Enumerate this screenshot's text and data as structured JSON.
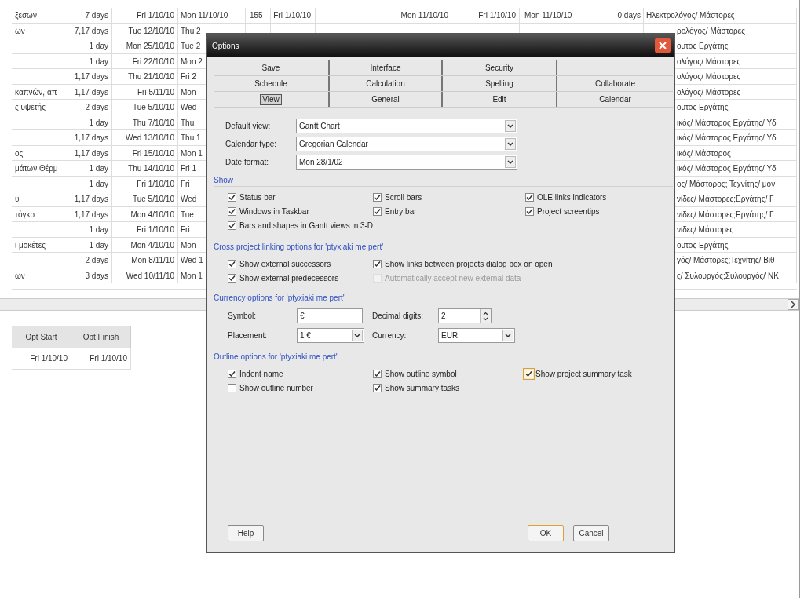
{
  "table": {
    "rows": [
      {
        "column_1": "ξεσων",
        "column_2": "7 days",
        "column_3": "Fri 1/10/10",
        "column_4": "Mon 11/10/10",
        "column_5": "155",
        "column_6": "Fri 1/10/10",
        "column_7": "Mon 11/10/10",
        "column_8": "Fri 1/10/10",
        "column_9": "Mon 11/10/10",
        "column_10": "0 days",
        "column_11": "Ηλεκτρολόγος/ Μάστορες"
      },
      {
        "column_1": "ων",
        "column_2": "7,17 days",
        "column_3": "Tue 12/10/10",
        "column_4": "Thu 2",
        "column_11": "ρολόγος/ Μάστορες"
      },
      {
        "column_2": "1 day",
        "column_3": "Mon 25/10/10",
        "column_4": "Tue 2",
        "column_11": "ουτος Εργάτης"
      },
      {
        "column_2": "1 day",
        "column_3": "Fri 22/10/10",
        "column_4": "Mon 2",
        "column_11": "ολόγος/ Μάστορες"
      },
      {
        "column_2": "1,17 days",
        "column_3": "Thu 21/10/10",
        "column_4": "Fri 2",
        "column_11": "ολόγος/ Μάστορες"
      },
      {
        "column_1": "καπνών, απ",
        "column_2": "1,17 days",
        "column_3": "Fri 5/11/10",
        "column_4": "Mon",
        "column_11": "ολόγος/ Μάστορες"
      },
      {
        "column_1": "ς υψετής",
        "column_2": "2 days",
        "column_3": "Tue 5/10/10",
        "column_4": "Wed",
        "column_11": "ουτος Εργάτης"
      },
      {
        "column_2": "1 day",
        "column_3": "Thu 7/10/10",
        "column_4": "Thu",
        "column_11": "ικός/ Μάστορος Εργάτης/ Υδ"
      },
      {
        "column_2": "1,17 days",
        "column_3": "Wed 13/10/10",
        "column_4": "Thu 1",
        "column_11": "ικός/ Μάστορος Εργάτης/ Υδ"
      },
      {
        "column_1": "ος",
        "column_2": "1,17 days",
        "column_3": "Fri 15/10/10",
        "column_4": "Mon 1",
        "column_11": "ικός/ Μάστορος"
      },
      {
        "column_1": "μάτων Θέρμ",
        "column_2": "1 day",
        "column_3": "Thu 14/10/10",
        "column_4": "Fri 1",
        "column_11": "ικός/ Μάστορος Εργάτης/ Υδ"
      },
      {
        "column_2": "1 day",
        "column_3": "Fri 1/10/10",
        "column_4": "Fri",
        "column_11": "ος/ Μάστορος; Τεχνίτης/ μον"
      },
      {
        "column_1": "υ",
        "column_2": "1,17 days",
        "column_3": "Tue 5/10/10",
        "column_4": "Wed",
        "column_11": "νίδες/ Μάστορες;Εργάτης/ Γ"
      },
      {
        "column_1": "τόγκο",
        "column_2": "1,17 days",
        "column_3": "Mon 4/10/10",
        "column_4": "Tue",
        "column_11": "νίδες/ Μάστορες;Εργάτης/ Γ"
      },
      {
        "column_2": "1 day",
        "column_3": "Fri 1/10/10",
        "column_4": "Fri",
        "column_11": "νίδες/ Μάστορες"
      },
      {
        "column_1": "ι μοκέτες",
        "column_2": "1 day",
        "column_3": "Mon 4/10/10",
        "column_4": "Mon",
        "column_11": "ουτος Εργάτης"
      },
      {
        "column_2": "2 days",
        "column_3": "Mon 8/11/10",
        "column_4": "Wed 1",
        "column_11": "γός/ Μάστορες;Τεχνίτης/ Βιθ"
      },
      {
        "column_1": "ων",
        "column_2": "3 days",
        "column_3": "Wed 10/11/10",
        "column_4": "Mon 1",
        "column_11": "ς/ Συλουργός;Συλουργός/ ΝΚ"
      }
    ]
  },
  "lower_table": {
    "columns": [
      "Opt Start",
      "Opt Finish"
    ],
    "rows": [
      [
        "Fri 1/10/10",
        "Fri 1/10/10"
      ]
    ]
  },
  "dialog": {
    "title": "Options",
    "tabs": [
      [
        {
          "label": "Save",
          "selected": false
        },
        {
          "label": "Interface",
          "selected": false
        },
        {
          "label": "Security",
          "selected": false
        }
      ],
      [
        {
          "label": "Schedule",
          "selected": false
        },
        {
          "label": "Calculation",
          "selected": false
        },
        {
          "label": "Spelling",
          "selected": false
        },
        {
          "label": "Collaborate",
          "selected": false
        }
      ],
      [
        {
          "label": "View",
          "selected": true
        },
        {
          "label": "General",
          "selected": false
        },
        {
          "label": "Edit",
          "selected": false
        },
        {
          "label": "Calendar",
          "selected": false
        }
      ]
    ],
    "fields": [
      {
        "label": "Default view:",
        "value": "Gantt Chart"
      },
      {
        "label": "Calendar type:",
        "value": "Gregorian Calendar"
      },
      {
        "label": "Date format:",
        "value": "Mon 28/1/02"
      }
    ],
    "show": {
      "heading": "Show",
      "checkboxes": [
        {
          "label": "Status bar",
          "checked": true,
          "disabled": false,
          "focused": false
        },
        {
          "label": "Scroll bars",
          "checked": true,
          "disabled": false,
          "focused": false
        },
        {
          "label": "OLE links indicators",
          "checked": true,
          "disabled": false,
          "focused": false
        },
        {
          "label": "Windows in Taskbar",
          "checked": true,
          "disabled": false,
          "focused": false
        },
        {
          "label": "Entry bar",
          "checked": true,
          "disabled": false,
          "focused": false
        },
        {
          "label": "Project screentips",
          "checked": true,
          "disabled": false,
          "focused": false
        },
        {
          "label": "Bars and shapes in Gantt views in 3-D",
          "checked": true,
          "disabled": false,
          "focused": false
        }
      ]
    },
    "cross_project": {
      "heading": "Cross project linking options for 'ptyxiaki me pert'",
      "checkboxes": [
        {
          "label": "Show external successors",
          "checked": true,
          "disabled": false,
          "focused": false
        },
        {
          "label": "Show links between projects dialog box on open",
          "checked": true,
          "disabled": false,
          "focused": false
        },
        {
          "label": "Show external predecessors",
          "checked": true,
          "disabled": false,
          "focused": false
        },
        {
          "label": "Automatically accept new external data",
          "checked": false,
          "disabled": true,
          "focused": false
        }
      ]
    },
    "currency": {
      "heading": "Currency options for 'ptyxiaki me pert'",
      "symbol_label": "Symbol:",
      "symbol": "€",
      "decimal_label": "Decimal digits:",
      "decimal_digits": "2",
      "placement_label": "Placement:",
      "placement": "1 €",
      "currency_label": "Currency:",
      "currency": "EUR"
    },
    "outline": {
      "heading": "Outline options for 'ptyxiaki me pert'",
      "checkboxes": [
        {
          "label": "Indent name",
          "checked": true,
          "disabled": false,
          "focused": false
        },
        {
          "label": "Show outline symbol",
          "checked": true,
          "disabled": false,
          "focused": false
        },
        {
          "label": "Show project summary task",
          "checked": true,
          "disabled": false,
          "focused": true
        },
        {
          "label": "Show outline number",
          "checked": false,
          "disabled": false,
          "focused": false
        },
        {
          "label": "Show summary tasks",
          "checked": true,
          "disabled": false,
          "focused": false
        }
      ]
    },
    "buttons": [
      {
        "label": "Help",
        "default": false
      },
      {
        "label": "OK",
        "default": true
      },
      {
        "label": "Cancel",
        "default": false
      }
    ]
  }
}
